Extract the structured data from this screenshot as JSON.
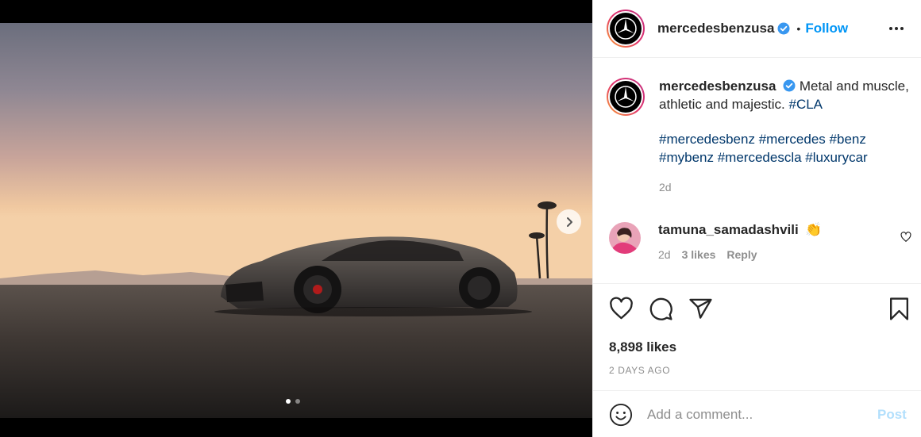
{
  "post": {
    "username": "mercedesbenzusa",
    "follow_label": "Follow",
    "separator": "•",
    "caption_text": "Metal and muscle, athletic and majestic.",
    "caption_tags_line1": [
      "#CLA"
    ],
    "hashtags_line1": [
      "#mercedesbenz",
      "#mercedes",
      "#benz"
    ],
    "hashtags_line2": [
      "#mybenz",
      "#mercedescla",
      "#luxurycar"
    ],
    "caption_time": "2d",
    "likes": "8,898 likes",
    "date": "2 DAYS AGO"
  },
  "comment": {
    "username": "tamuna_samadashvili",
    "emoji": "👏",
    "time": "2d",
    "likes": "3 likes",
    "reply": "Reply"
  },
  "add_comment": {
    "placeholder": "Add a comment...",
    "post_label": "Post"
  },
  "carousel": {
    "total": 2,
    "active": 1
  },
  "colors": {
    "accent": "#0095f6",
    "hashtag": "#00376b",
    "post_disabled": "#b2dffc",
    "muted": "#8e8e8e",
    "verified": "#3897f0"
  },
  "icons": [
    "chevron-right-icon",
    "more-icon",
    "verified-icon",
    "heart-icon",
    "comment-icon",
    "share-icon",
    "bookmark-icon",
    "emoji-icon"
  ]
}
